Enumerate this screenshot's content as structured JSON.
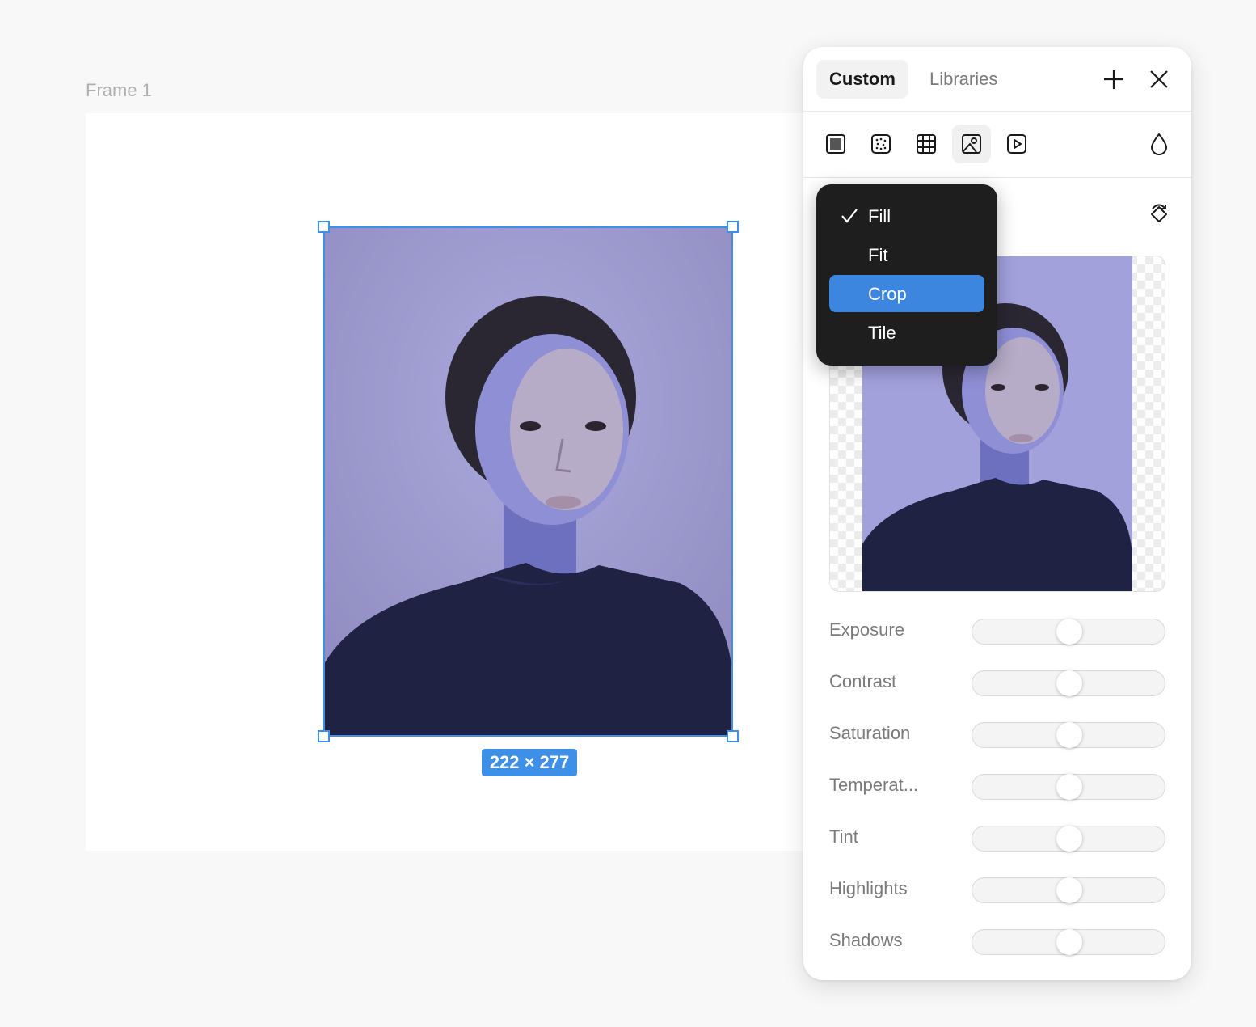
{
  "canvas": {
    "frame_label": "Frame 1",
    "dimensions_badge": "222 × 277"
  },
  "panel": {
    "tabs": [
      {
        "label": "Custom",
        "active": true
      },
      {
        "label": "Libraries",
        "active": false
      }
    ],
    "header_icons": [
      "plus-icon",
      "close-icon"
    ],
    "fill_types": [
      {
        "icon": "solid-fill-icon",
        "active": false
      },
      {
        "icon": "noise-fill-icon",
        "active": false
      },
      {
        "icon": "pattern-fill-icon",
        "active": false
      },
      {
        "icon": "image-fill-icon",
        "active": true
      },
      {
        "icon": "video-fill-icon",
        "active": false
      }
    ],
    "eyedropper_icon": "drop-icon",
    "swap_icon": "rotate-icon",
    "adjustments": [
      {
        "label": "Exposure",
        "value": 0.5
      },
      {
        "label": "Contrast",
        "value": 0.5
      },
      {
        "label": "Saturation",
        "value": 0.5
      },
      {
        "label": "Temperat...",
        "value": 0.5
      },
      {
        "label": "Tint",
        "value": 0.5
      },
      {
        "label": "Highlights",
        "value": 0.5
      },
      {
        "label": "Shadows",
        "value": 0.5
      }
    ]
  },
  "dropdown": {
    "items": [
      {
        "label": "Fill",
        "checked": true,
        "highlighted": false
      },
      {
        "label": "Fit",
        "checked": false,
        "highlighted": false
      },
      {
        "label": "Crop",
        "checked": false,
        "highlighted": true
      },
      {
        "label": "Tile",
        "checked": false,
        "highlighted": false
      }
    ]
  },
  "colors": {
    "accent": "#3d8fe8",
    "dropdown_bg": "#1e1e1e",
    "highlight": "#3d86e0"
  }
}
